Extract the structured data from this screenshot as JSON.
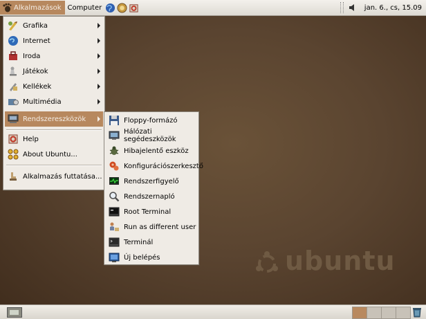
{
  "top_panel": {
    "apps_menu_label": "Alkalmazások",
    "computer_menu_label": "Computer",
    "clock": "jan. 6., cs, 15.09"
  },
  "apps_menu": {
    "items": [
      {
        "label": "Grafika",
        "icon": "graphics-icon",
        "has_submenu": true
      },
      {
        "label": "Internet",
        "icon": "globe-icon",
        "has_submenu": true
      },
      {
        "label": "Iroda",
        "icon": "office-icon",
        "has_submenu": true
      },
      {
        "label": "Játékok",
        "icon": "games-icon",
        "has_submenu": true
      },
      {
        "label": "Kellékek",
        "icon": "accessories-icon",
        "has_submenu": true
      },
      {
        "label": "Multimédia",
        "icon": "multimedia-icon",
        "has_submenu": true
      },
      {
        "label": "Rendszereszközök",
        "icon": "system-tools-icon",
        "has_submenu": true,
        "selected": true
      },
      {
        "label": "Help",
        "icon": "help-icon",
        "has_submenu": false
      },
      {
        "label": "About Ubuntu...",
        "icon": "about-ubuntu-icon",
        "has_submenu": false
      },
      {
        "label": "Alkalmazás futtatása...",
        "icon": "run-application-icon",
        "has_submenu": false
      }
    ]
  },
  "system_tools_submenu": {
    "items": [
      {
        "label": "Floppy-formázó",
        "icon": "floppy-icon"
      },
      {
        "label": "Hálózati segédeszközök",
        "icon": "network-tools-icon"
      },
      {
        "label": "Hibajelentő eszköz",
        "icon": "bug-report-icon"
      },
      {
        "label": "Konfigurációszerkesztő",
        "icon": "config-editor-icon"
      },
      {
        "label": "Rendszerfigyelő",
        "icon": "system-monitor-icon"
      },
      {
        "label": "Rendszernapló",
        "icon": "system-log-icon"
      },
      {
        "label": "Root Terminal",
        "icon": "root-terminal-icon"
      },
      {
        "label": "Run as different user",
        "icon": "run-as-user-icon"
      },
      {
        "label": "Terminál",
        "icon": "terminal-icon"
      },
      {
        "label": "Új belépés",
        "icon": "new-login-icon"
      }
    ]
  },
  "desktop": {
    "watermark_text": "ubuntu"
  },
  "colors": {
    "highlight": "#b7885e",
    "menu_bg": "#efebe5",
    "desktop_bg": "#5a4430"
  }
}
